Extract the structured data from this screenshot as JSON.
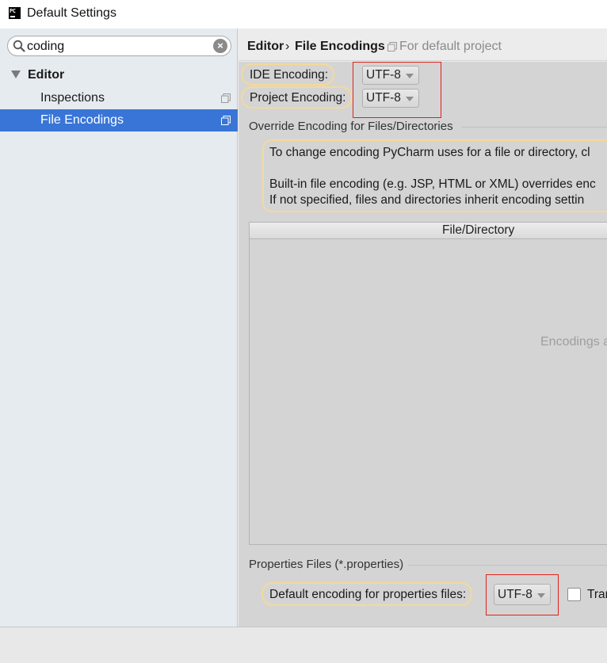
{
  "window": {
    "title": "Default Settings",
    "app_icon_text": "PC"
  },
  "sidebar": {
    "search": {
      "value": "coding"
    },
    "tree": {
      "editor_label": "Editor",
      "items": [
        {
          "label": "Inspections"
        },
        {
          "label": "File Encodings"
        }
      ]
    }
  },
  "breadcrumb": {
    "section": "Editor",
    "separator": "›",
    "page": "File Encodings",
    "scope": "For default project"
  },
  "encodings": {
    "ide_label": "IDE Encoding:",
    "ide_value": "UTF-8",
    "project_label": "Project Encoding:",
    "project_value": "UTF-8"
  },
  "override_group": {
    "title": "Override Encoding for Files/Directories",
    "info_line1": "To change encoding PyCharm uses for a file or directory, cl",
    "info_line2": "Built-in file encoding (e.g. JSP, HTML or XML) overrides enc",
    "info_line3": "If not specified, files and directories inherit encoding settin",
    "table": {
      "column_header": "File/Directory",
      "empty_text": "Encodings a"
    }
  },
  "properties_group": {
    "title": "Properties Files (*.properties)",
    "default_label": "Default encoding for properties files:",
    "default_value": "UTF-8",
    "checkbox_label": "Tran"
  },
  "colors": {
    "selection": "#3875d7",
    "highlight_border": "#f5d99a",
    "annotation_red": "#e0211d"
  }
}
